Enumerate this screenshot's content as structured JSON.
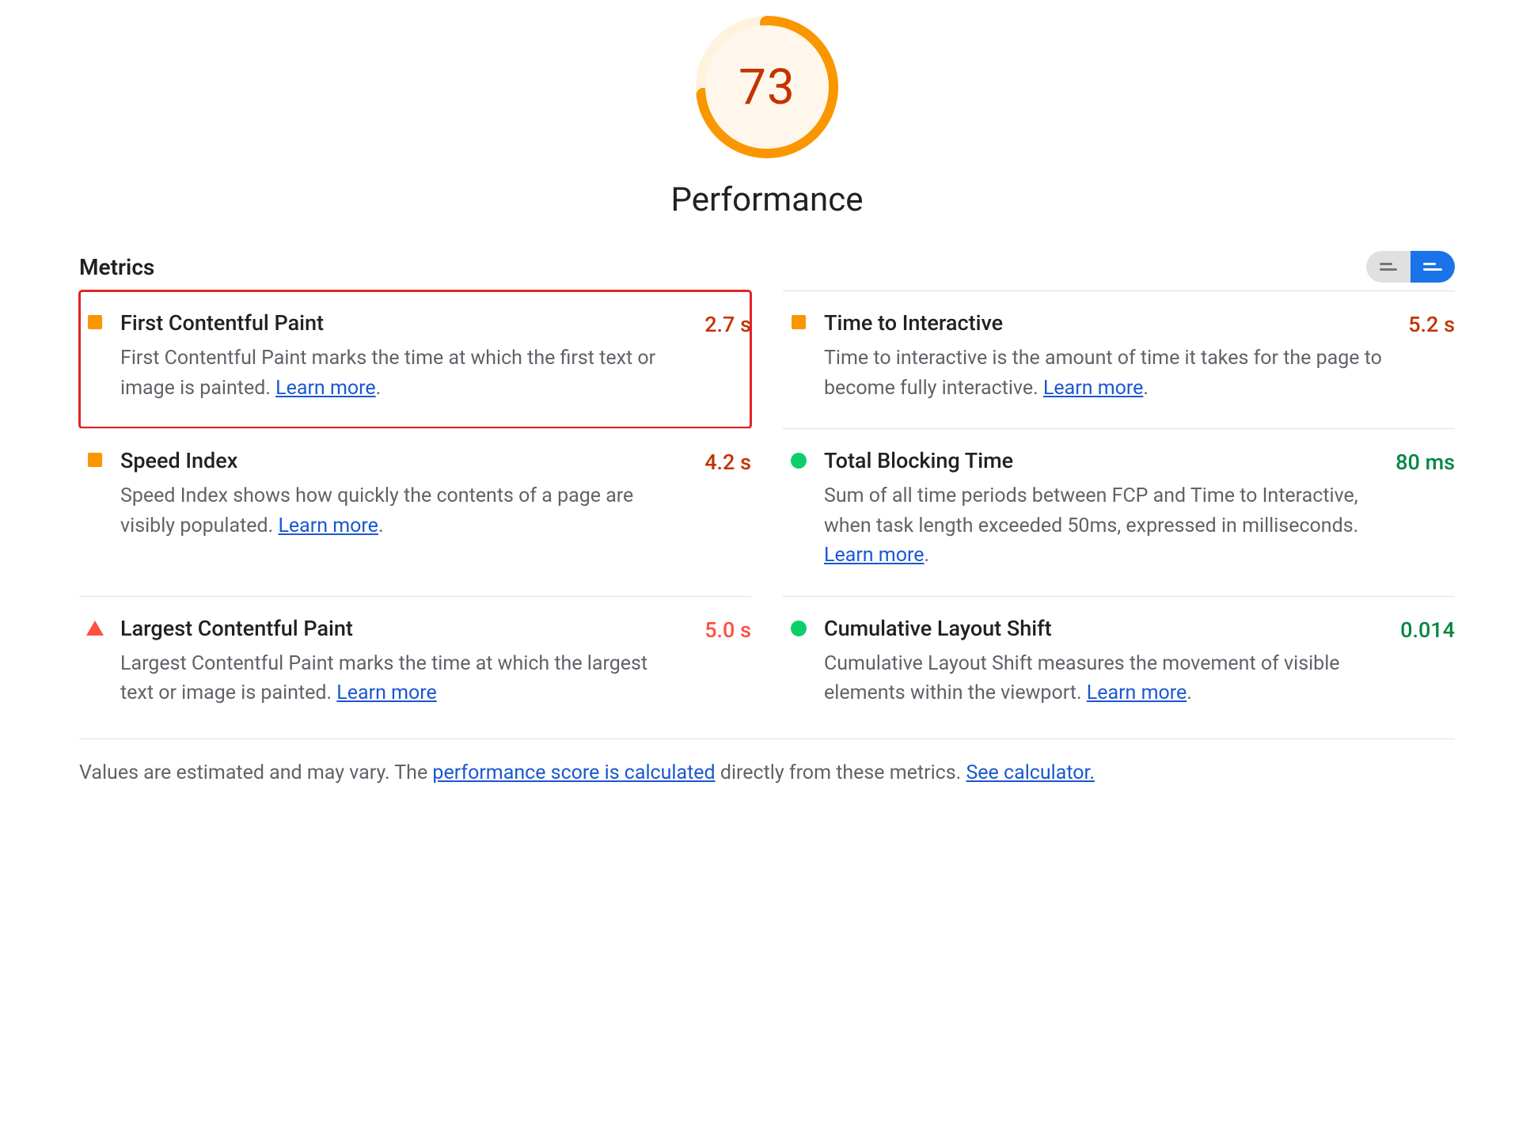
{
  "gauge": {
    "score": "73",
    "score_num": 73,
    "title": "Performance",
    "color": "#fa9600"
  },
  "metrics_header": {
    "label": "Metrics"
  },
  "metrics": [
    {
      "status": "average",
      "title": "First Contentful Paint",
      "desc_pre": "First Contentful Paint marks the time at which the first text or image is painted. ",
      "learn": "Learn more",
      "desc_post": ".",
      "value": "2.7 s",
      "value_class": "val-orange",
      "highlight": true
    },
    {
      "status": "average",
      "title": "Time to Interactive",
      "desc_pre": "Time to interactive is the amount of time it takes for the page to become fully interactive. ",
      "learn": "Learn more",
      "desc_post": ".",
      "value": "5.2 s",
      "value_class": "val-orange",
      "highlight": false
    },
    {
      "status": "average",
      "title": "Speed Index",
      "desc_pre": "Speed Index shows how quickly the contents of a page are visibly populated. ",
      "learn": "Learn more",
      "desc_post": ".",
      "value": "4.2 s",
      "value_class": "val-orange",
      "highlight": false
    },
    {
      "status": "good",
      "title": "Total Blocking Time",
      "desc_pre": "Sum of all time periods between FCP and Time to Interactive, when task length exceeded 50ms, expressed in milliseconds. ",
      "learn": "Learn more",
      "desc_post": ".",
      "value": "80 ms",
      "value_class": "val-green",
      "highlight": false
    },
    {
      "status": "poor",
      "title": "Largest Contentful Paint",
      "desc_pre": "Largest Contentful Paint marks the time at which the largest text or image is painted. ",
      "learn": "Learn more",
      "desc_post": "",
      "value": "5.0 s",
      "value_class": "val-red",
      "highlight": false
    },
    {
      "status": "good",
      "title": "Cumulative Layout Shift",
      "desc_pre": "Cumulative Layout Shift measures the movement of visible elements within the viewport. ",
      "learn": "Learn more",
      "desc_post": ".",
      "value": "0.014",
      "value_class": "val-green",
      "highlight": false
    }
  ],
  "footnote": {
    "pre": "Values are estimated and may vary. The ",
    "link1": "performance score is calculated",
    "mid": " directly from these metrics. ",
    "link2": "See calculator."
  }
}
